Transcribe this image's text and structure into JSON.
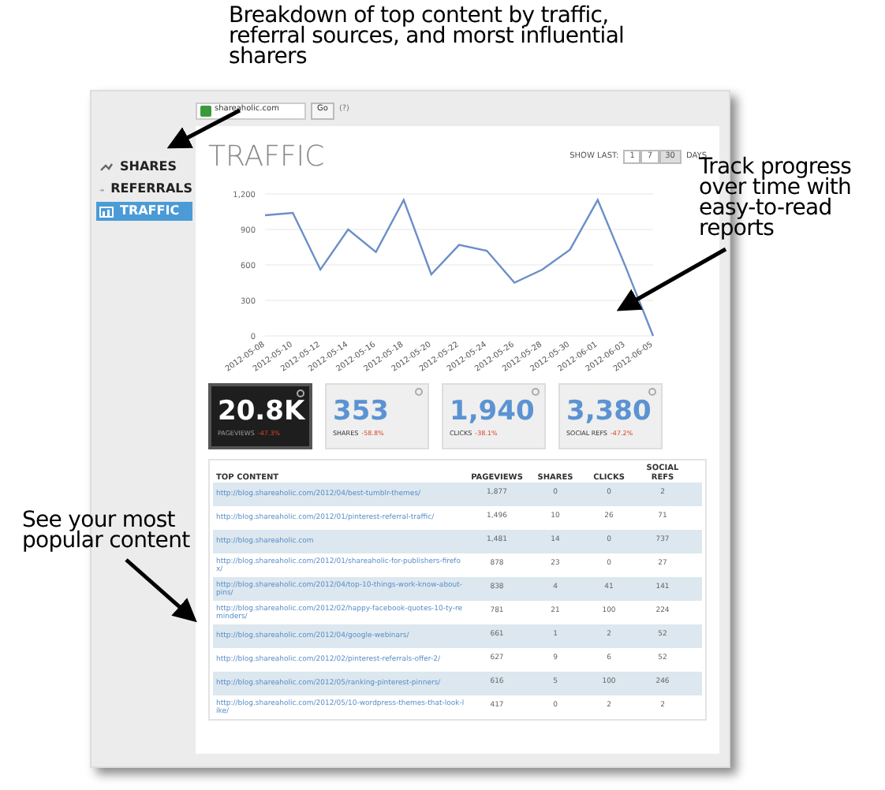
{
  "annotations": [
    {
      "text": "Breakdown of top content by traffic, referral sources, and morst influential sharers"
    },
    {
      "text": "Track progress over time with easy-to-read reports"
    },
    {
      "text": "See your most popular content"
    }
  ],
  "browser": {
    "url": "shareaholic.com",
    "go_button": "Go",
    "help": "(?)"
  },
  "sidebar": {
    "items": [
      {
        "label": "SHARES",
        "selected": false
      },
      {
        "label": "REFERRALS",
        "selected": false
      },
      {
        "label": "TRAFFIC",
        "selected": true
      }
    ]
  },
  "main": {
    "title": "TRAFFIC",
    "range": {
      "label": "SHOW LAST:",
      "options": [
        {
          "label": "1",
          "selected": false
        },
        {
          "label": "7",
          "selected": false
        },
        {
          "label": "30",
          "selected": true
        }
      ],
      "unit": "DAYS"
    },
    "chart_data": {
      "type": "line",
      "grid": true,
      "categories": [
        "2012-05-08",
        "2012-05-10",
        "2012-05-12",
        "2012-05-14",
        "2012-05-16",
        "2012-05-18",
        "2012-05-20",
        "2012-05-22",
        "2012-05-24",
        "2012-05-26",
        "2012-05-28",
        "2012-05-30",
        "2012-06-01",
        "2012-06-03",
        "2012-06-05"
      ],
      "series": [
        {
          "color": "#6a8fc8",
          "values": [
            1020,
            1040,
            560,
            900,
            710,
            1150,
            520,
            770,
            720,
            450,
            560,
            730,
            1150,
            590,
            0
          ]
        }
      ],
      "ylim": [
        0,
        1200
      ],
      "yticks": [
        0,
        {
          "value": 300,
          "label": "300"
        },
        {
          "value": 600,
          "label": "600"
        },
        {
          "value": 900,
          "label": "900"
        },
        {
          "value": 1200,
          "label": "1,200"
        }
      ]
    },
    "stats": [
      {
        "value": "20.8K",
        "label": "PAGEVIEWS",
        "delta": "-47.3%",
        "selected": true
      },
      {
        "value": "353",
        "label": "SHARES",
        "delta": "-58.8%",
        "selected": false
      },
      {
        "value": "1,940",
        "label": "CLICKS",
        "delta": "-38.1%",
        "selected": false
      },
      {
        "value": "3,380",
        "label": "SOCIAL REFS",
        "delta": "-47.2%",
        "selected": false
      }
    ],
    "table": {
      "columns": [
        "TOP CONTENT",
        "PAGEVIEWS",
        "SHARES",
        "CLICKS",
        "SOCIAL REFS"
      ],
      "rows": [
        [
          "http://blog.shareaholic.com/2012/04/best-tumblr-themes/",
          "1,877",
          "0",
          "0",
          "2"
        ],
        [
          "http://blog.shareaholic.com/2012/01/pinterest-referral-traffic/",
          "1,496",
          "10",
          "26",
          "71"
        ],
        [
          "http://blog.shareaholic.com",
          "1,481",
          "14",
          "0",
          "737"
        ],
        [
          "http://blog.shareaholic.com/2012/01/shareaholic-for-publishers-firefox/",
          "878",
          "23",
          "0",
          "27"
        ],
        [
          "http://blog.shareaholic.com/2012/04/top-10-things-work-know-about-pins/",
          "838",
          "4",
          "41",
          "141"
        ],
        [
          "http://blog.shareaholic.com/2012/02/happy-facebook-quotes-10-ty-reminders/",
          "781",
          "21",
          "100",
          "224"
        ],
        [
          "http://blog.shareaholic.com/2012/04/google-webinars/",
          "661",
          "1",
          "2",
          "52"
        ],
        [
          "http://blog.shareaholic.com/2012/02/pinterest-referrals-offer-2/",
          "627",
          "9",
          "6",
          "52"
        ],
        [
          "http://blog.shareaholic.com/2012/05/ranking-pinterest-pinners/",
          "616",
          "5",
          "100",
          "246"
        ],
        [
          "http://blog.shareaholic.com/2012/05/10-wordpress-themes-that-look-like/",
          "417",
          "0",
          "2",
          "2"
        ]
      ]
    }
  }
}
